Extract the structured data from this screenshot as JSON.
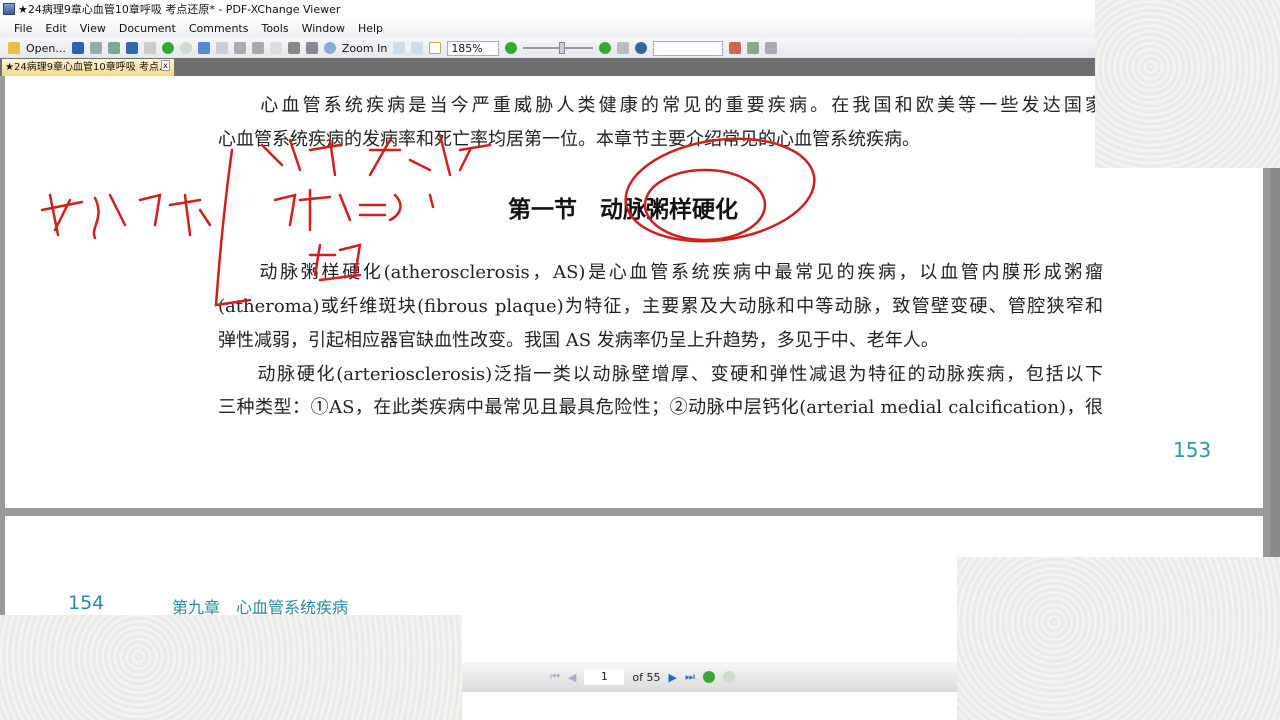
{
  "window": {
    "title": "★24病理9章心血管10章呼吸 考点还原* - PDF-XChange Viewer"
  },
  "menu": [
    "File",
    "Edit",
    "View",
    "Document",
    "Comments",
    "Tools",
    "Window",
    "Help"
  ],
  "toolbar": {
    "open_label": "Open...",
    "zoom_in_label": "Zoom In",
    "zoom_value": "185%"
  },
  "tab": {
    "label": "★24病理9章心血管10章呼吸 考点... *"
  },
  "page1": {
    "lines": [
      "　　心血管系统疾病是当今严重威胁人类健康的常见的重要疾病。在我国和欧美等一些发达国家",
      "心血管系统疾病的发病率和死亡率均居第一位。本章节主要介绍常见的心血管系统疾病。",
      "　　动脉粥样硬化(atherosclerosis，AS)是心血管系统疾病中最常见的疾病，以血管内膜形成粥瘤",
      "(atheroma)或纤维斑块(fibrous plaque)为特征，主要累及大动脉和中等动脉，致管壁变硬、管腔狭窄和",
      "弹性减弱，引起相应器官缺血性改变。我国 AS 发病率仍呈上升趋势，多见于中、老年人。",
      "　　动脉硬化(arteriosclerosis)泛指一类以动脉壁增厚、变硬和弹性减退为特征的动脉疾病，包括以下",
      "三种类型：①AS，在此类疾病中最常见且最具危险性；②动脉中层钙化(arterial medial calcification)，很"
    ],
    "heading": "第一节　动脉粥样硬化",
    "page_number": "153"
  },
  "page2": {
    "page_number": "154",
    "chapter": "第九章　心血管系统疾病"
  },
  "nav": {
    "current_page": "1",
    "of_pages": "of 55"
  },
  "colors": {
    "ink": "#d0201c",
    "teal": "#2a9aa8"
  }
}
